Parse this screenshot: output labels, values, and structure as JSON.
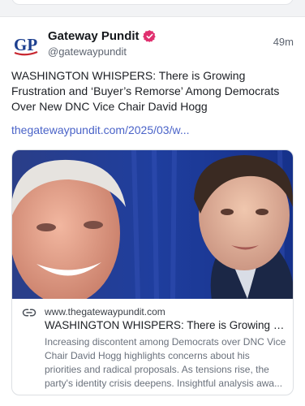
{
  "post": {
    "author_name": "Gateway Pundit",
    "author_handle": "@gatewaypundit",
    "timestamp": "49m",
    "logo_text": "GP",
    "verified_color": "#e0306f",
    "text": "WASHINGTON WHISPERS: There is Growing Frustration and ‘Buyer’s Remorse’ Among Democrats Over New DNC Vice Chair David Hogg",
    "link_text": "thegatewaypundit.com/2025/03/w..."
  },
  "preview": {
    "domain": "www.thegatewaypundit.com",
    "title": "WASHINGTON WHISPERS: There is Growing Fr...",
    "description": "Increasing discontent among Democrats over DNC Vice Chair David Hogg highlights concerns about his priorities and radical proposals. As tensions rise, the party's identity crisis deepens. Insightful analysis awa..."
  },
  "colors": {
    "link": "#4a63c8",
    "logo_blue": "#1c3f8f",
    "logo_red": "#c8262f"
  }
}
